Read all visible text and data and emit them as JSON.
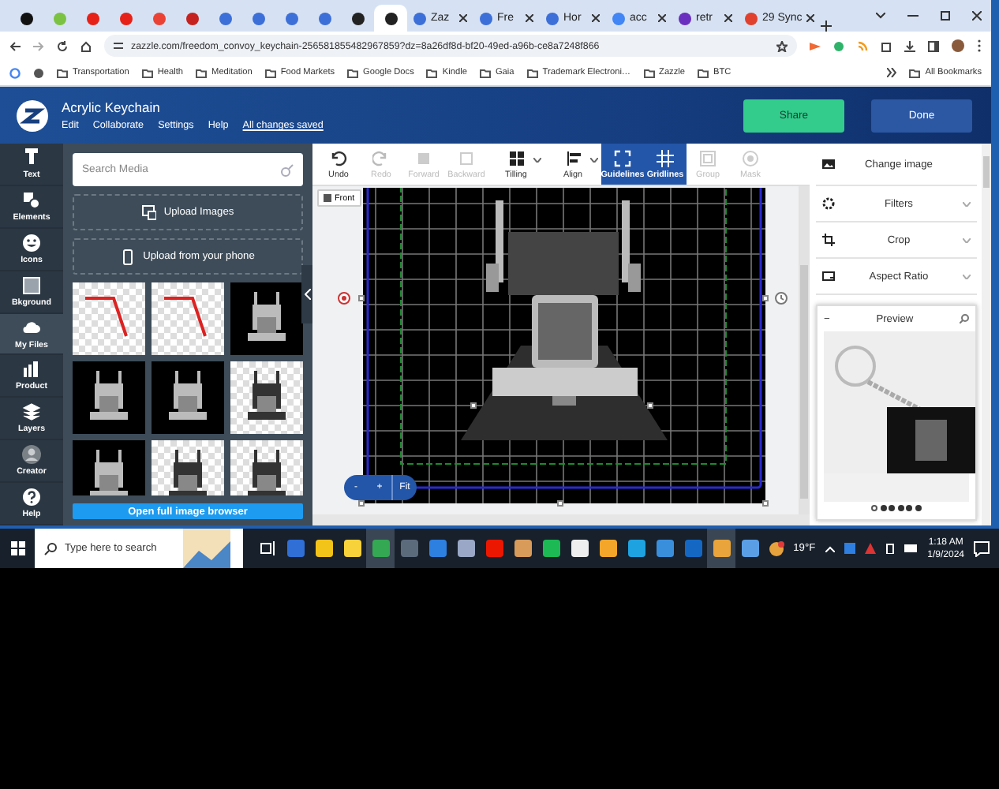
{
  "browser": {
    "tabs": [
      {
        "kind": "icon",
        "color": "#111111",
        "selected": false
      },
      {
        "kind": "icon",
        "color": "#7cc242",
        "selected": false
      },
      {
        "kind": "icon",
        "color": "#e62117",
        "selected": false
      },
      {
        "kind": "icon",
        "color": "#e62117",
        "selected": false
      },
      {
        "kind": "icon",
        "color": "#ea4335",
        "selected": false
      },
      {
        "kind": "icon",
        "color": "#c5221f",
        "selected": false
      },
      {
        "kind": "icon",
        "color": "#3d6fd8",
        "selected": false
      },
      {
        "kind": "icon",
        "color": "#3d6fd8",
        "selected": false
      },
      {
        "kind": "icon",
        "color": "#3d6fd8",
        "selected": false
      },
      {
        "kind": "icon",
        "color": "#3d6fd8",
        "selected": false
      },
      {
        "kind": "icon",
        "color": "#222222",
        "selected": false
      },
      {
        "kind": "icon",
        "color": "#222222",
        "selected": true
      },
      {
        "kind": "text",
        "color": "#3d6fd8",
        "label": "Zaz",
        "selected": false
      },
      {
        "kind": "text",
        "color": "#3d6fd8",
        "label": "Fre",
        "selected": false
      },
      {
        "kind": "text",
        "color": "#3d6fd8",
        "label": "Hor",
        "selected": false
      },
      {
        "kind": "text",
        "color": "#4285f4",
        "label": "acc",
        "selected": false
      },
      {
        "kind": "text",
        "color": "#6b2fbf",
        "label": "retr",
        "selected": false
      },
      {
        "kind": "text",
        "color": "#e0412f",
        "label": "29 Sync",
        "selected": false
      }
    ],
    "url": "zazzle.com/freedom_convoy_keychain-256581855482967859?dz=8a26df8d-bf20-49ed-a96b-ce8a7248f866",
    "bookmarks": [
      "Transportation",
      "Health",
      "Meditation",
      "Food Markets",
      "Google Docs",
      "Kindle",
      "Gaia",
      "Trademark Electroni…",
      "Zazzle",
      "BTC"
    ],
    "all_bookmarks": "All Bookmarks"
  },
  "header": {
    "title": "Acrylic Keychain",
    "menu": [
      "Edit",
      "Collaborate",
      "Settings",
      "Help"
    ],
    "status": "All changes saved",
    "share": "Share",
    "done": "Done"
  },
  "rail": [
    {
      "label": "Text",
      "selected": false
    },
    {
      "label": "Elements",
      "selected": false
    },
    {
      "label": "Icons",
      "selected": false
    },
    {
      "label": "Bkground",
      "selected": false
    },
    {
      "label": "My Files",
      "selected": true
    },
    {
      "label": "Product",
      "selected": false
    },
    {
      "label": "Layers",
      "selected": false
    },
    {
      "label": "Creator",
      "selected": false
    },
    {
      "label": "Help",
      "selected": false
    }
  ],
  "media": {
    "search": {
      "placeholder": "Search Media"
    },
    "uploads": [
      "Upload Images",
      "Upload from your phone"
    ],
    "thumbnails": [
      {
        "kind": "transparent"
      },
      {
        "kind": "transparent"
      },
      {
        "kind": "dark"
      },
      {
        "kind": "dark"
      },
      {
        "kind": "dark"
      },
      {
        "kind": "light"
      },
      {
        "kind": "dark"
      },
      {
        "kind": "light"
      },
      {
        "kind": "light"
      }
    ],
    "browse": "Open full image browser"
  },
  "toolbar": [
    {
      "label": "Undo",
      "disabled": false,
      "selected": false,
      "dropdown": false
    },
    {
      "label": "Redo",
      "disabled": true,
      "selected": false,
      "dropdown": false
    },
    {
      "label": "Forward",
      "disabled": true,
      "selected": false,
      "dropdown": false
    },
    {
      "label": "Backward",
      "disabled": true,
      "selected": false,
      "dropdown": false
    },
    {
      "label": "Tilling",
      "disabled": false,
      "selected": false,
      "dropdown": true
    },
    {
      "label": "Align",
      "disabled": false,
      "selected": false,
      "dropdown": true
    },
    {
      "label": "Guidelines",
      "disabled": false,
      "selected": true,
      "dropdown": false
    },
    {
      "label": "Gridlines",
      "disabled": false,
      "selected": true,
      "dropdown": false
    },
    {
      "label": "Group",
      "disabled": true,
      "selected": false,
      "dropdown": false
    },
    {
      "label": "Mask",
      "disabled": true,
      "selected": false,
      "dropdown": false
    }
  ],
  "canvas": {
    "side": "Front",
    "zoom": [
      "-",
      "+",
      "Fit"
    ]
  },
  "options": [
    {
      "label": "Change image",
      "expandable": false
    },
    {
      "label": "Filters",
      "expandable": true
    },
    {
      "label": "Crop",
      "expandable": true
    },
    {
      "label": "Aspect Ratio",
      "expandable": true
    }
  ],
  "preview": {
    "collapse": "−",
    "title": "Preview",
    "pages": [
      {
        "selected": true
      },
      {
        "selected": false
      },
      {
        "selected": false
      },
      {
        "selected": false
      },
      {
        "selected": false
      },
      {
        "selected": false
      }
    ]
  },
  "taskbar": {
    "search": {
      "placeholder": "Type here to search"
    },
    "apps": [
      {
        "color": "#2f6fd6",
        "selected": false
      },
      {
        "color": "#f2c318",
        "selected": false
      },
      {
        "color": "#f7d23a",
        "selected": false
      },
      {
        "color": "#34a853",
        "selected": true
      },
      {
        "color": "#5b6b7c",
        "selected": false
      },
      {
        "color": "#2d7fe0",
        "selected": false
      },
      {
        "color": "#9aa7c6",
        "selected": false
      },
      {
        "color": "#eb1700",
        "selected": false
      },
      {
        "color": "#d89b5a",
        "selected": false
      },
      {
        "color": "#1db954",
        "selected": false
      },
      {
        "color": "#eeeeee",
        "selected": false
      },
      {
        "color": "#f4a62a",
        "selected": false
      },
      {
        "color": "#1fa2e0",
        "selected": false
      },
      {
        "color": "#3a8fdc",
        "selected": false
      },
      {
        "color": "#1468c4",
        "selected": false
      },
      {
        "color": "#e9a53b",
        "selected": true
      },
      {
        "color": "#5a9fe6",
        "selected": false
      }
    ],
    "weather": "19°F",
    "time": "1:18 AM",
    "date": "1/9/2024"
  }
}
